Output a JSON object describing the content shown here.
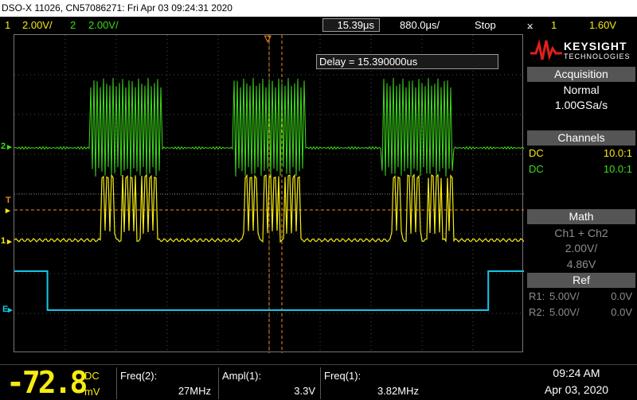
{
  "title_bar": "DSO-X 11026, CN57086271: Fri Apr 03 09:24:31 2020",
  "status": {
    "ch1_num": "1",
    "ch1_scale": "2.00V/",
    "ch2_num": "2",
    "ch2_scale": "2.00V/",
    "time_pos": "15.39μs",
    "timebase": "880.0μs/",
    "run_state": "Stop",
    "trigger_source": "1",
    "trigger_level": "1.60V"
  },
  "delay_box": "Delay = 15.390000us",
  "markers": {
    "ch2": "2",
    "ch1": "1",
    "trigger": "T",
    "ext": "E"
  },
  "brand": {
    "name": "KEYSIGHT",
    "sub": "TECHNOLOGIES"
  },
  "acquisition": {
    "title": "Acquisition",
    "mode": "Normal",
    "rate": "1.00GSa/s"
  },
  "channels": {
    "title": "Channels",
    "rows": [
      {
        "coupling": "DC",
        "probe": "10.0:1"
      },
      {
        "coupling": "DC",
        "probe": "10.0:1"
      }
    ]
  },
  "math": {
    "title": "Math",
    "func": "Ch1 + Ch2",
    "scale": "2.00V/",
    "offset": "4.86V"
  },
  "ref": {
    "title": "Ref",
    "rows": [
      {
        "name": "R1:",
        "scale": "5.00V/",
        "offset": "0.0V"
      },
      {
        "name": "R2:",
        "scale": "5.00V/",
        "offset": "0.0V"
      }
    ]
  },
  "dvm": {
    "value": "-72.8",
    "coupling": "DC",
    "unit": "mV"
  },
  "measurements": [
    {
      "label": "Freq(2):",
      "value": "27MHz"
    },
    {
      "label": "Ampl(1):",
      "value": "3.3V"
    },
    {
      "label": "Freq(1):",
      "value": "3.82MHz"
    }
  ],
  "clock": {
    "time": "09:24 AM",
    "date": "Apr 03, 2020"
  },
  "colors": {
    "ch1": "#f5ea13",
    "ch2": "#3ddc1a",
    "ext": "#15c6e8",
    "cursor": "#f08a1c"
  },
  "traces": {
    "ch2_burst_periods": [
      [
        0.15,
        0.29
      ],
      [
        0.43,
        0.57
      ],
      [
        0.72,
        0.86
      ]
    ],
    "ch1_low_periods": [
      [
        0.17,
        0.29
      ],
      [
        0.45,
        0.57
      ],
      [
        0.74,
        0.86
      ]
    ],
    "ext_high_until": 0.065,
    "ext_high_from": 0.93
  }
}
